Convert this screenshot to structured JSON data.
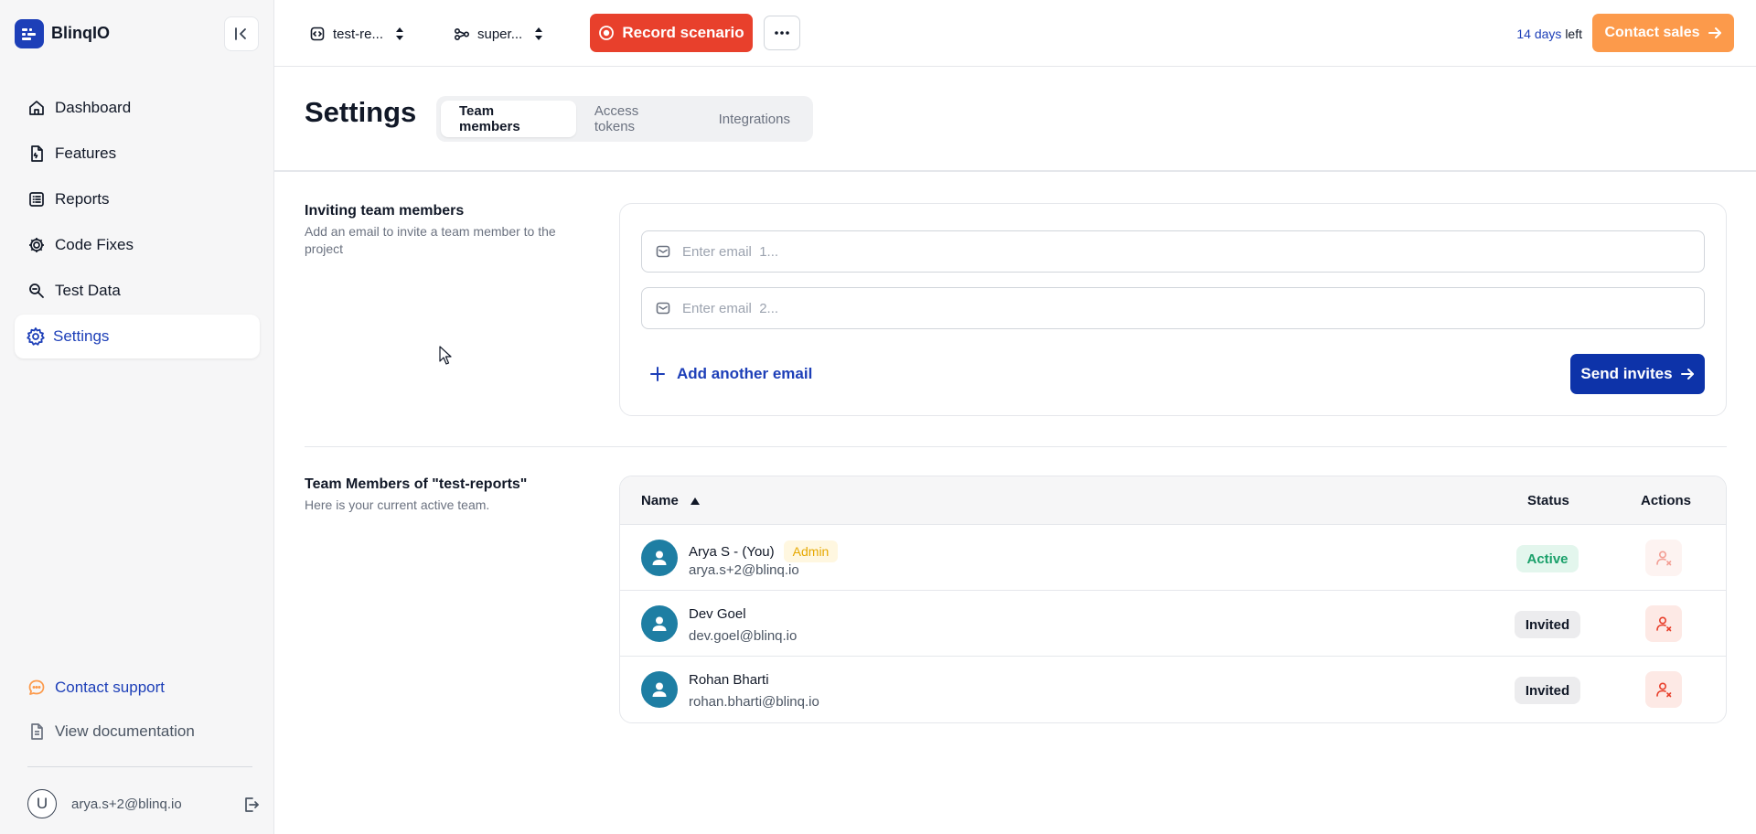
{
  "app": {
    "name": "BlinqIO"
  },
  "sidebar": {
    "items": [
      {
        "label": "Dashboard",
        "icon": "home-icon"
      },
      {
        "label": "Features",
        "icon": "feature-file-icon"
      },
      {
        "label": "Reports",
        "icon": "list-icon"
      },
      {
        "label": "Code Fixes",
        "icon": "gear-code-icon"
      },
      {
        "label": "Test Data",
        "icon": "search-data-icon"
      },
      {
        "label": "Settings",
        "icon": "gear-icon",
        "active": true
      }
    ],
    "support_label": "Contact support",
    "docs_label": "View documentation",
    "user_initial": "U",
    "user_email": "arya.s+2@blinq.io"
  },
  "topbar": {
    "project_selector": "test-re...",
    "environment_selector": "super...",
    "record_label": "Record scenario",
    "trial_days": "14 days",
    "trial_suffix": "left",
    "contact_label": "Contact sales"
  },
  "page": {
    "title": "Settings",
    "tabs": [
      {
        "label": "Team members",
        "active": true
      },
      {
        "label": "Access tokens"
      },
      {
        "label": "Integrations"
      }
    ]
  },
  "invite": {
    "title": "Inviting team members",
    "description": "Add an email to invite a team member to the project",
    "email_placeholders": [
      "Enter email  1...",
      "Enter email  2..."
    ],
    "add_label": "Add another email",
    "send_label": "Send invites"
  },
  "members": {
    "title": "Team Members of \"test-reports\"",
    "description": "Here is your current active team.",
    "columns": {
      "name": "Name",
      "status": "Status",
      "actions": "Actions"
    },
    "rows": [
      {
        "name": "Arya S - (You)",
        "badge": "Admin",
        "email": "arya.s+2@blinq.io",
        "status": "Active"
      },
      {
        "name": "Dev Goel",
        "email": "dev.goel@blinq.io",
        "status": "Invited"
      },
      {
        "name": "Rohan Bharti",
        "email": "rohan.bharti@blinq.io",
        "status": "Invited"
      }
    ]
  },
  "colors": {
    "brand": "#1d3fb8",
    "record": "#e8402c",
    "contact": "#fc9a4b",
    "send": "#0d33a9",
    "active_status": "#1aa06a",
    "admin_badge": "#e6a800",
    "avatar": "#1e7ea3"
  }
}
